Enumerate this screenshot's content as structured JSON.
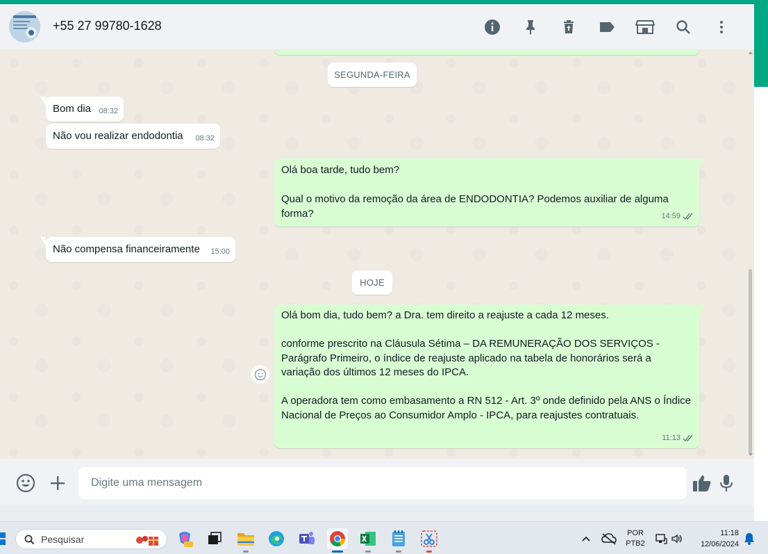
{
  "header": {
    "contact_name": "+55 27 99780-1628",
    "icons": [
      "info-icon",
      "pin-icon",
      "delete-icon",
      "label-icon",
      "catalog-icon",
      "search-icon",
      "menu-icon"
    ]
  },
  "chat": {
    "day_separators": {
      "monday": "SEGUNDA-FEIRA",
      "today": "HOJE"
    },
    "messages": [
      {
        "dir": "in",
        "text": "Bom dia",
        "time": "08:32"
      },
      {
        "dir": "in",
        "text": "Não vou realizar endodontia",
        "time": "08:32"
      },
      {
        "dir": "out",
        "text": "Olá boa tarde, tudo bem?\n\nQual o motivo da remoção da área de ENDODONTIA? Podemos auxiliar de alguma forma?",
        "time": "14:59",
        "status": "read"
      },
      {
        "dir": "in",
        "text": "Não compensa financeiramente",
        "time": "15:00"
      },
      {
        "dir": "out",
        "text": "Olá bom dia, tudo bem? a Dra. tem direito a reajuste a cada 12 meses.\n\nconforme prescrito na Cláusula Sétima – DA REMUNERAÇÃO DOS SERVIÇOS - Parágrafo Primeiro, o índice de reajuste aplicado na tabela de honorários será a variação dos últimos 12 meses do IPCA.\n\nA operadora tem como embasamento a RN 512 - Art. 3º onde definido pela ANS o Índice Nacional de Preços ao Consumidor Amplo - IPCA, para reajustes contratuais.",
        "time": "11:13",
        "status": "read"
      }
    ]
  },
  "composer": {
    "placeholder": "Digite uma mensagem"
  },
  "taskbar": {
    "search_label": "Pesquisar",
    "lang_line1": "POR",
    "lang_line2": "PTB2",
    "time": "11:18",
    "date": "12/06/2024"
  },
  "colors": {
    "accent": "#00a884",
    "outgoing_bubble": "#d9fdd3",
    "incoming_bubble": "#ffffff",
    "chat_bg": "#efeae2",
    "read_tick": "#667781"
  }
}
